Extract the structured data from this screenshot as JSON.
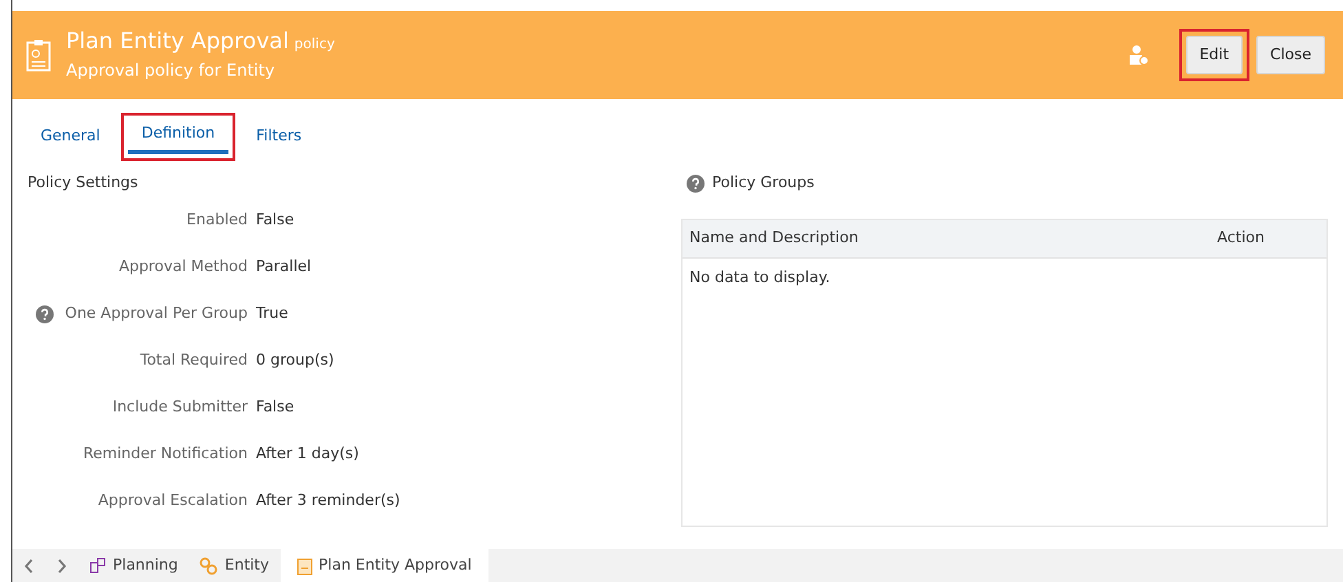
{
  "header": {
    "title": "Plan Entity Approval",
    "title_suffix": "policy",
    "subtitle": "Approval policy for Entity",
    "buttons": [
      {
        "label": "Edit",
        "highlighted": true
      },
      {
        "label": "Close",
        "highlighted": false
      }
    ]
  },
  "tabs": [
    {
      "label": "General",
      "selected": false,
      "highlighted": false
    },
    {
      "label": "Definition",
      "selected": true,
      "highlighted": true
    },
    {
      "label": "Filters",
      "selected": false,
      "highlighted": false
    }
  ],
  "policy_settings": {
    "title": "Policy Settings",
    "fields": [
      {
        "label": "Enabled",
        "value": "False",
        "help": false
      },
      {
        "label": "Approval Method",
        "value": "Parallel",
        "help": false
      },
      {
        "label": "One Approval Per Group",
        "value": "True",
        "help": true
      },
      {
        "label": "Total Required",
        "value": "0 group(s)",
        "help": false
      },
      {
        "label": "Include Submitter",
        "value": "False",
        "help": false
      },
      {
        "label": "Reminder Notification",
        "value": "After 1 day(s)",
        "help": false
      },
      {
        "label": "Approval Escalation",
        "value": "After 3 reminder(s)",
        "help": false
      }
    ]
  },
  "policy_groups": {
    "title": "Policy Groups",
    "columns": [
      "Name and Description",
      "Action"
    ],
    "empty_message": "No data to display."
  },
  "bottom_tabs": [
    {
      "label": "Planning",
      "kind": "planning",
      "selected": false
    },
    {
      "label": "Entity",
      "kind": "entity",
      "selected": false
    },
    {
      "label": "Plan Entity Approval",
      "kind": "policy",
      "selected": true
    }
  ]
}
